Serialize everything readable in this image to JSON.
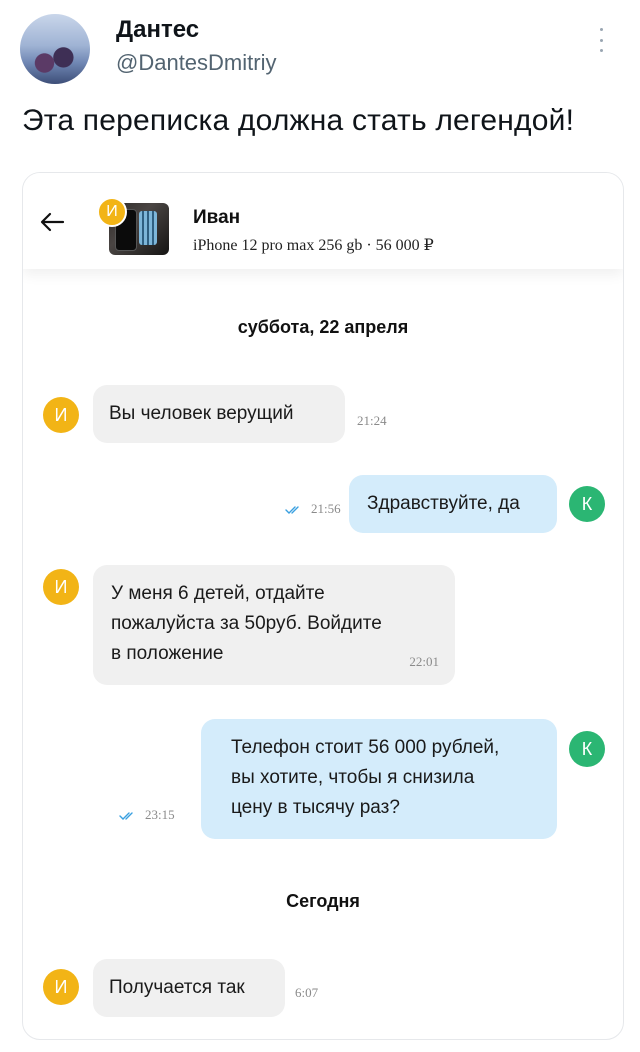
{
  "tweet": {
    "author_name": "Дантес",
    "author_handle": "@DantesDmitriy",
    "text": "Эта переписка должна стать легендой!"
  },
  "chat": {
    "header": {
      "contact_name": "Иван",
      "contact_initial": "И",
      "product": "iPhone 12 pro max 256 gb · 56 000 ₽"
    },
    "groups": [
      {
        "date_label": "суббота, 22 апреля"
      },
      {
        "date_label": "Сегодня"
      }
    ],
    "messages": [
      {
        "side": "in",
        "initial": "И",
        "text": "Вы человек верущий",
        "time": "21:24"
      },
      {
        "side": "out",
        "initial": "К",
        "text": "Здравствуйте, да",
        "time": "21:56"
      },
      {
        "side": "in",
        "initial": "И",
        "text_lines": [
          "У меня 6 детей, отдайте",
          "пожалуйста за 50руб. Войдите",
          "в положение"
        ],
        "time": "22:01"
      },
      {
        "side": "out",
        "initial": "К",
        "text_lines": [
          "Телефон стоит 56 000 рублей,",
          "вы хотите, чтобы я снизила",
          "цену в тысячу раз?"
        ],
        "time": "23:15"
      },
      {
        "side": "in",
        "initial": "И",
        "text": "Получается так",
        "time": "6:07"
      }
    ]
  },
  "colors": {
    "incoming_bubble": "#f0f0f0",
    "outgoing_bubble": "#d4ecfb",
    "avatar_ivan": "#f2b416",
    "avatar_k": "#2bb673",
    "read_ticks": "#3aa0e0"
  }
}
